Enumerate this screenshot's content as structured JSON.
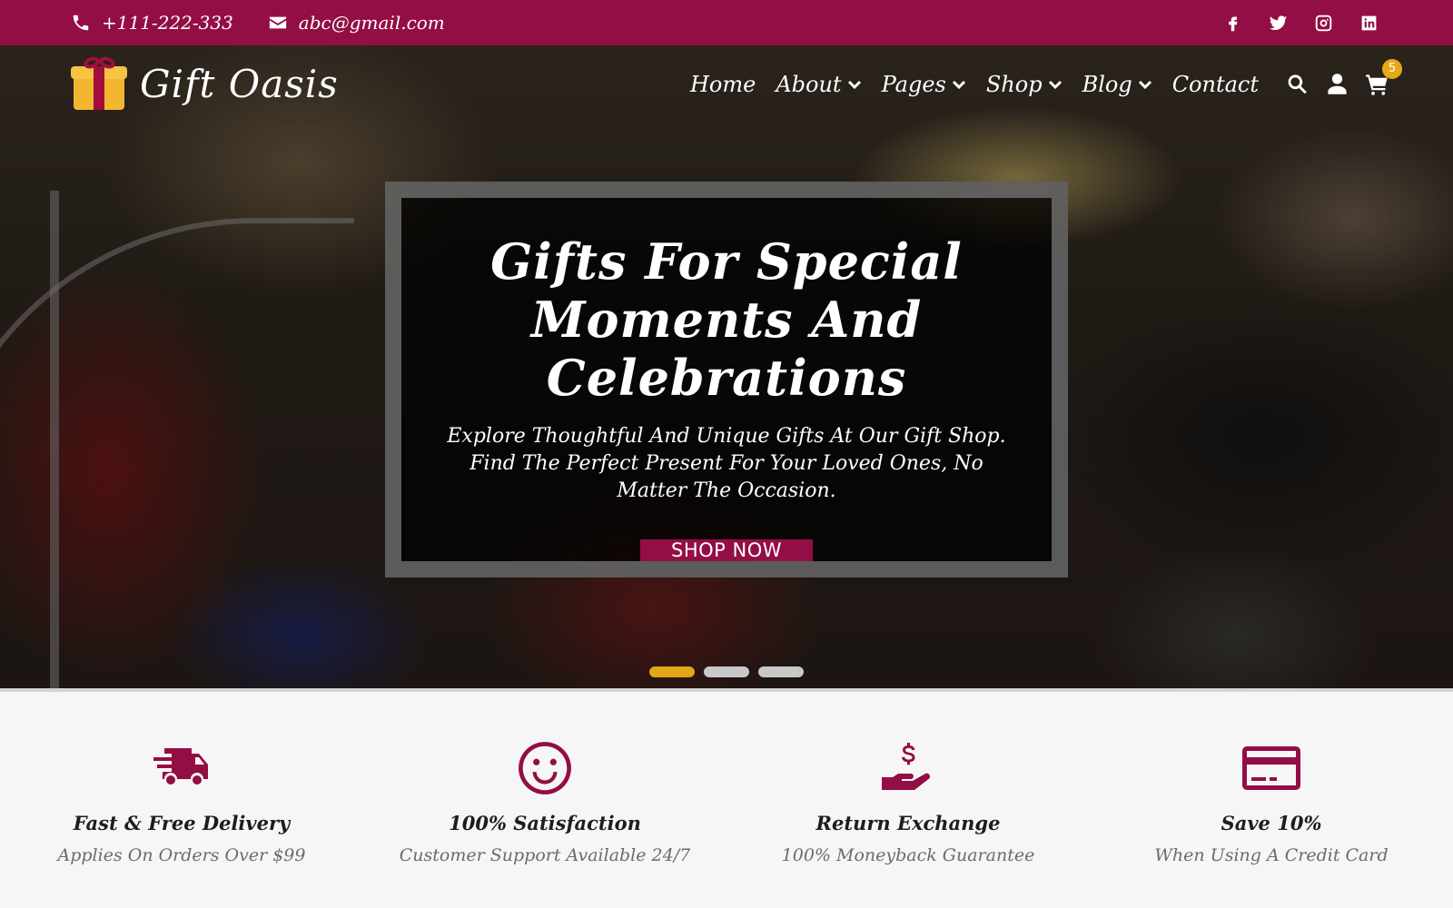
{
  "topbar": {
    "phone": "+111-222-333",
    "email": "abc@gmail.com",
    "social_icons": [
      "facebook-icon",
      "twitter-icon",
      "instagram-icon",
      "linkedin-icon"
    ]
  },
  "brand": {
    "name": "Gift Oasis",
    "logo_icon": "gift-box-icon"
  },
  "nav": {
    "items": [
      {
        "label": "Home",
        "dropdown": false
      },
      {
        "label": "About",
        "dropdown": true
      },
      {
        "label": "Pages",
        "dropdown": true
      },
      {
        "label": "Shop",
        "dropdown": true
      },
      {
        "label": "Blog",
        "dropdown": true
      },
      {
        "label": "Contact",
        "dropdown": false
      }
    ],
    "icons": [
      "search-icon",
      "user-icon",
      "cart-icon"
    ],
    "cart_count": "5"
  },
  "hero": {
    "title": "Gifts For Special Moments And Celebrations",
    "text": "Explore Thoughtful And Unique Gifts At Our Gift Shop. Find The Perfect Present For Your Loved Ones, No Matter The Occasion.",
    "button_label": "SHOP NOW",
    "slides": 3,
    "active_slide": 1
  },
  "features": [
    {
      "icon": "delivery-truck-icon",
      "title": "Fast & Free Delivery",
      "subtitle": "Applies On Orders Over $99"
    },
    {
      "icon": "smiley-face-icon",
      "title": "100% Satisfaction",
      "subtitle": "Customer Support Available 24/7"
    },
    {
      "icon": "money-hand-icon",
      "title": "Return Exchange",
      "subtitle": "100% Moneyback Guarantee"
    },
    {
      "icon": "credit-card-icon",
      "title": "Save 10%",
      "subtitle": "When Using A Credit Card"
    }
  ],
  "colors": {
    "brand": "#930e44",
    "accent": "#e2a714",
    "background": "#f6f6f6"
  }
}
